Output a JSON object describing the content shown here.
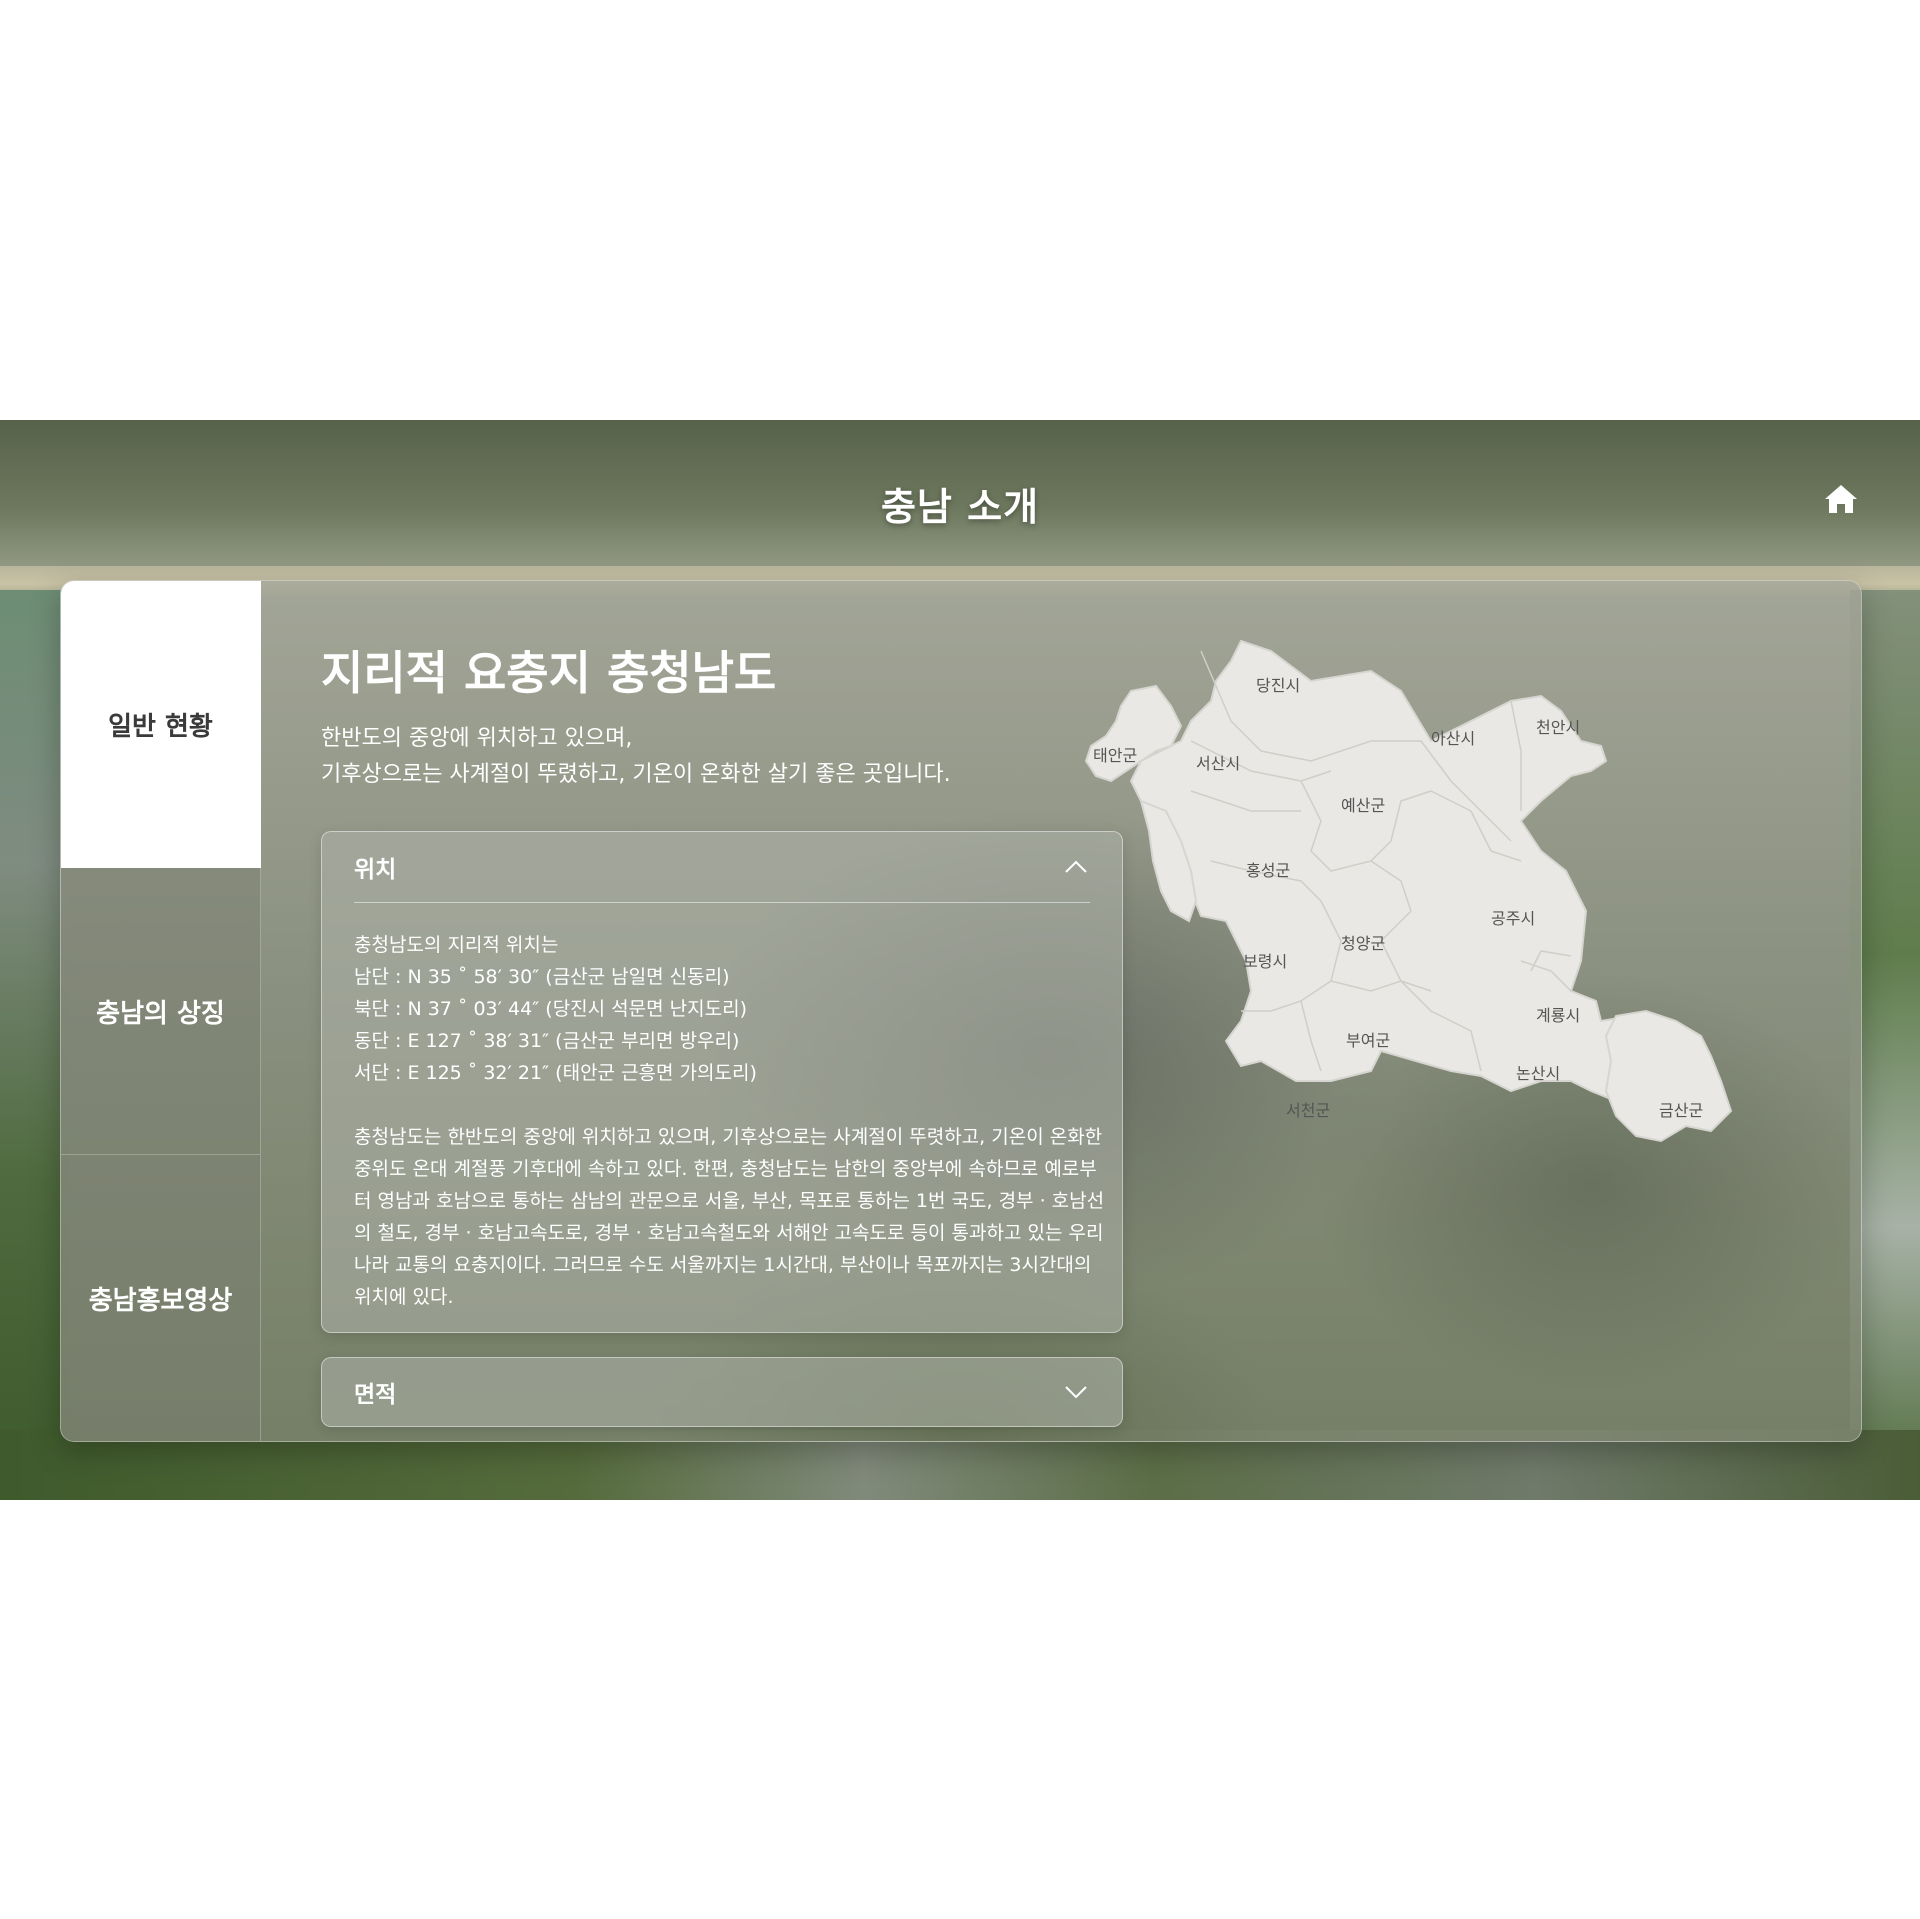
{
  "header": {
    "title": "충남 소개",
    "home_icon": "home-icon"
  },
  "sidebar": {
    "items": [
      {
        "label": "일반 현황",
        "active": true
      },
      {
        "label": "충남의 상징",
        "active": false
      },
      {
        "label": "충남홍보영상",
        "active": false
      }
    ]
  },
  "main": {
    "heading": "지리적 요충지 충청남도",
    "intro_lines": [
      "한반도의 중앙에 위치하고 있으며,",
      "기후상으로는 사계절이 뚜렸하고, 기온이 온화한 살기 좋은 곳입니다."
    ],
    "accordions": [
      {
        "title": "위치",
        "expanded": true,
        "chevron": "chevron-up-icon",
        "lines": [
          "충청남도의 지리적 위치는",
          "남단 : N 35 ˚ 58′ 30″ (금산군 남일면 신동리)",
          "북단 : N 37 ˚ 03′ 44″ (당진시 석문면 난지도리)",
          "동단 : E 127 ˚ 38′ 31″ (금산군 부리면 방우리)",
          "서단 : E 125 ˚ 32′ 21″ (태안군 근흥면 가의도리)"
        ],
        "paragraph_lines": [
          "충청남도는 한반도의 중앙에 위치하고 있으며, 기후상으로는 사계절이 뚜렷하고, 기온이 온화한",
          "중위도 온대 계절풍 기후대에 속하고 있다. 한편, 충청남도는 남한의 중앙부에 속하므로 예로부",
          "터 영남과 호남으로 통하는 삼남의 관문으로 서울, 부산, 목포로 통하는 1번 국도, 경부 · 호남선",
          "의 철도, 경부 · 호남고속도로, 경부 · 호남고속철도와 서해안 고속도로 등이 통과하고 있는 우리",
          "나라 교통의 요충지이다. 그러므로 수도 서울까지는 1시간대, 부산이나 목포까지는 3시간대의",
          "위치에 있다."
        ]
      },
      {
        "title": "면적",
        "expanded": false,
        "chevron": "chevron-down-icon"
      }
    ]
  },
  "map": {
    "regions": [
      "당진시",
      "천안시",
      "아산시",
      "태안군",
      "서산시",
      "예산군",
      "홍성군",
      "공주시",
      "청양군",
      "보령시",
      "계룡시",
      "부여군",
      "논산시",
      "서천군",
      "금산군"
    ]
  },
  "colors": {
    "active_tab_bg": "#ffffff",
    "active_tab_text": "#3a3a3a",
    "text": "#ffffff",
    "map_fill": "#e9e8e4",
    "map_border": "#c9c8c3"
  }
}
